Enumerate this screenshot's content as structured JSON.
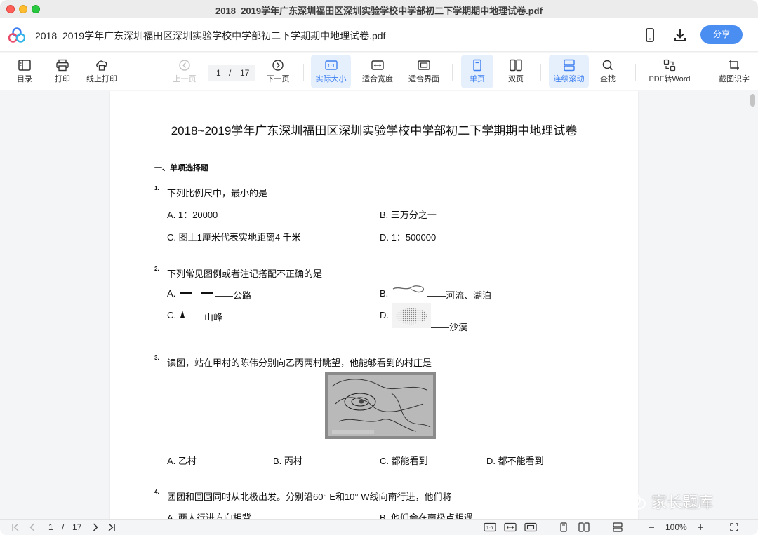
{
  "window": {
    "title": "2018_2019学年广东深圳福田区深圳实验学校中学部初二下学期期中地理试卷.pdf"
  },
  "header": {
    "doc_name": "2018_2019学年广东深圳福田区深圳实验学校中学部初二下学期期中地理试卷.pdf",
    "share_label": "分享"
  },
  "toolbar": {
    "toc": "目录",
    "print": "打印",
    "online_print": "线上打印",
    "prev_page": "上一页",
    "current_page": "1",
    "page_sep": "/",
    "total_pages": "17",
    "next_page": "下一页",
    "actual_size": "实际大小",
    "fit_width": "适合宽度",
    "fit_window": "适合界面",
    "single_page": "单页",
    "double_page": "双页",
    "continuous_scroll": "连续滚动",
    "find": "查找",
    "pdf_to_word": "PDF转Word",
    "ocr": "截图识字"
  },
  "document": {
    "title": "2018~2019学年广东深圳福田区深圳实验学校中学部初二下学期期中地理试卷",
    "section": "一、单项选择题",
    "questions": [
      {
        "num": "1.",
        "text": "下列比例尺中，最小的是",
        "options": [
          "A. 1：20000",
          "B. 三万分之一",
          "C. 图上1厘米代表实地距离4 千米",
          "D. 1：500000"
        ]
      },
      {
        "num": "2.",
        "text": "下列常见图例或者注记搭配不正确的是",
        "options": [
          "A.",
          "——公路",
          "B.",
          "——河流、湖泊",
          "C.",
          "——山峰",
          "D.",
          "——沙漠"
        ]
      },
      {
        "num": "3.",
        "text": "读图，站在甲村的陈伟分别向乙丙两村眺望，他能够看到的村庄是",
        "options": [
          "A. 乙村",
          "B. 丙村",
          "C. 都能看到",
          "D. 都不能看到"
        ]
      },
      {
        "num": "4.",
        "text": "团团和圆圆同时从北极出发。分别沿60° E和10° W线向南行进，他们将",
        "options": [
          "A. 两人行进方向相背",
          "B. 他们会在南极点相遇"
        ]
      }
    ]
  },
  "bottombar": {
    "current_page": "1",
    "page_sep": "/",
    "total_pages": "17",
    "zoom": "100%",
    "actual_size_icon": "1:1"
  },
  "watermark": {
    "text": "家长题库"
  },
  "colors": {
    "accent": "#4b8ef2",
    "active_bg": "#e6f0fd",
    "active_text": "#3d7ff0"
  }
}
